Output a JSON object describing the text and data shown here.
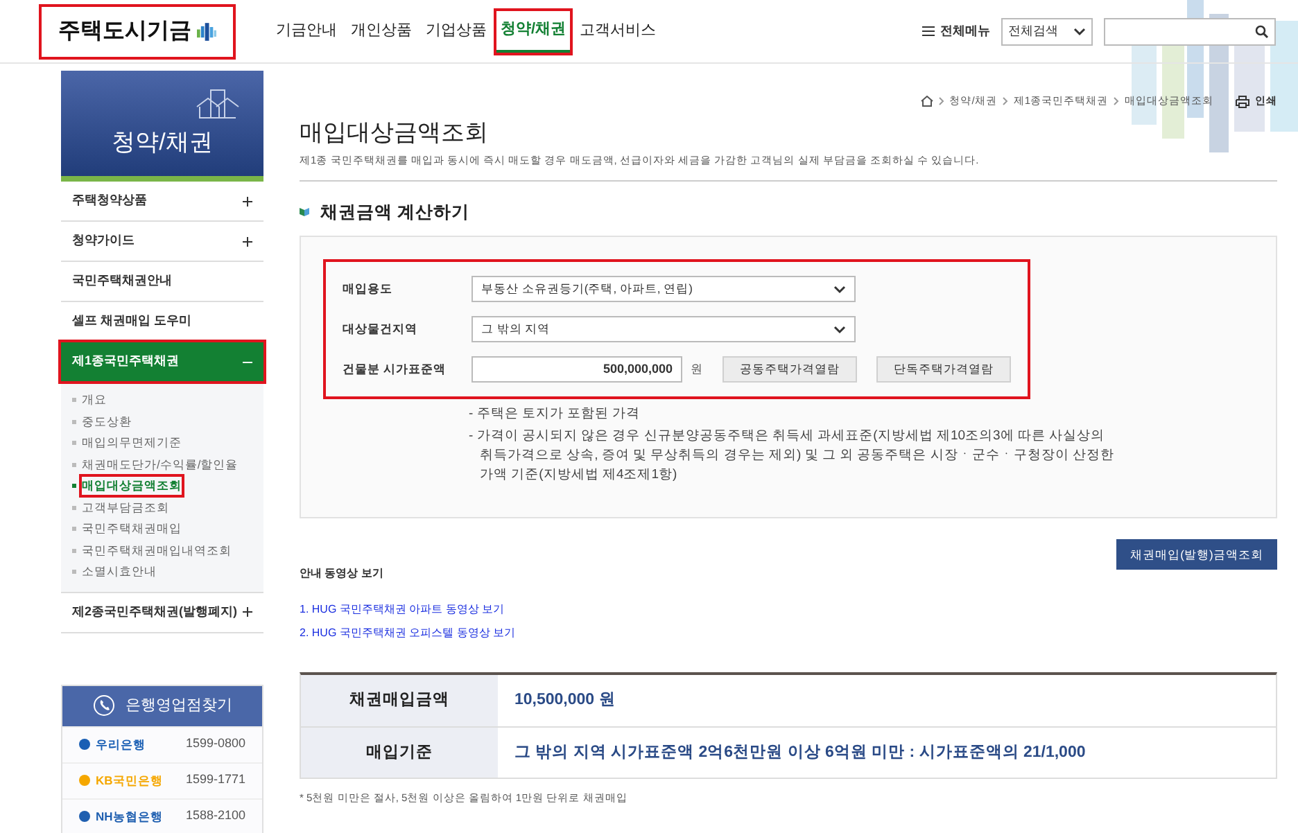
{
  "header": {
    "logo": {
      "text": "주택도시기금",
      "highlighted": true
    },
    "nav": [
      {
        "label": "기금안내",
        "selected": false,
        "highlighted": false
      },
      {
        "label": "개인상품",
        "selected": false,
        "highlighted": false
      },
      {
        "label": "기업상품",
        "selected": false,
        "highlighted": false
      },
      {
        "label": "청약/채권",
        "selected": true,
        "highlighted": true
      },
      {
        "label": "고객서비스",
        "selected": false,
        "highlighted": false
      }
    ],
    "all_menu": "전체메뉴",
    "search_scope": "전체검색"
  },
  "sidebar": {
    "title": "청약/채권",
    "items": [
      {
        "label": "주택청약상품",
        "kind": "toggle",
        "expanded": false,
        "highlighted": false
      },
      {
        "label": "청약가이드",
        "kind": "toggle",
        "expanded": false,
        "highlighted": false
      },
      {
        "label": "국민주택채권안내",
        "kind": "link",
        "highlighted": false
      },
      {
        "label": "셀프 채권매입 도우미",
        "kind": "link",
        "highlighted": false
      },
      {
        "label": "제1종국민주택채권",
        "kind": "toggle",
        "expanded": true,
        "highlighted": true,
        "children": [
          {
            "label": "개요",
            "selected": false,
            "highlighted": false
          },
          {
            "label": "중도상환",
            "selected": false,
            "highlighted": false
          },
          {
            "label": "매입의무면제기준",
            "selected": false,
            "highlighted": false
          },
          {
            "label": "채권매도단가/수익률/할인율",
            "selected": false,
            "highlighted": false
          },
          {
            "label": "매입대상금액조회",
            "selected": true,
            "highlighted": true
          },
          {
            "label": "고객부담금조회",
            "selected": false,
            "highlighted": false
          },
          {
            "label": "국민주택채권매입",
            "selected": false,
            "highlighted": false
          },
          {
            "label": "국민주택채권매입내역조회",
            "selected": false,
            "highlighted": false
          },
          {
            "label": "소멸시효안내",
            "selected": false,
            "highlighted": false
          }
        ]
      },
      {
        "label": "제2종국민주택채권(발행폐지)",
        "kind": "toggle",
        "expanded": false,
        "highlighted": false
      }
    ],
    "banks": {
      "title": "은행영업점찾기",
      "items": [
        {
          "name": "우리은행",
          "phone": "1599-0800",
          "color": "#1a5fb4"
        },
        {
          "name": "KB국민은행",
          "phone": "1599-1771",
          "color": "#f5a700"
        },
        {
          "name": "NH농협은행",
          "phone": "1588-2100",
          "color": "#1f5fb0"
        }
      ]
    }
  },
  "breadcrumb": [
    "청약/채권",
    "제1종국민주택채권",
    "매입대상금액조회"
  ],
  "print": "인쇄",
  "title": "매입대상금액조회",
  "description": "제1종 국민주택채권를 매입과 동시에 즉시 매도할 경우 매도금액, 선급이자와 세금을 가감한 고객님의 실제 부담금을 조회하실 수 있습니다.",
  "section_title": "채권금액 계산하기",
  "form": {
    "highlighted": true,
    "fields": [
      {
        "label": "매입용도",
        "kind": "select",
        "value": "부동산 소유권등기(주택, 아파트, 연립)"
      },
      {
        "label": "대상물건지역",
        "kind": "select",
        "value": "그 밖의 지역"
      },
      {
        "label": "건물분 시가표준액",
        "kind": "amount",
        "value": "500,000,000",
        "unit": "원",
        "buttons": [
          "공동주택가격열람",
          "단독주택가격열람"
        ]
      }
    ],
    "notes": [
      "- 주택은 토지가 포함된 가격",
      "- 가격이 공시되지 않은 경우 신규분양공동주택은 취득세 과세표준(지방세법 제10조의3에 따른 사실상의 취득가격으로 상속, 증여 및 무상취득의 경우는 제외) 및 그 외 공동주택은 시장ㆍ군수ㆍ구청장이 산정한 가액 기준(지방세법 제4조제1항)"
    ]
  },
  "submit": "채권매입(발행)금액조회",
  "videos": {
    "title": "안내 동영상 보기",
    "links": [
      "1. HUG 국민주택채권 아파트 동영상 보기",
      "2. HUG 국민주택채권 오피스텔 동영상 보기"
    ]
  },
  "result": [
    {
      "label": "채권매입금액",
      "value": "10,500,000 원"
    },
    {
      "label": "매입기준",
      "value": "그 밖의 지역 시가표준액 2억6천만원 이상 6억원 미만 : 시가표준액의 21/1,000"
    }
  ],
  "footnote": "* 5천원 미만은 절사, 5천원 이상은 올림하여 1만원 단위로 채권매입"
}
